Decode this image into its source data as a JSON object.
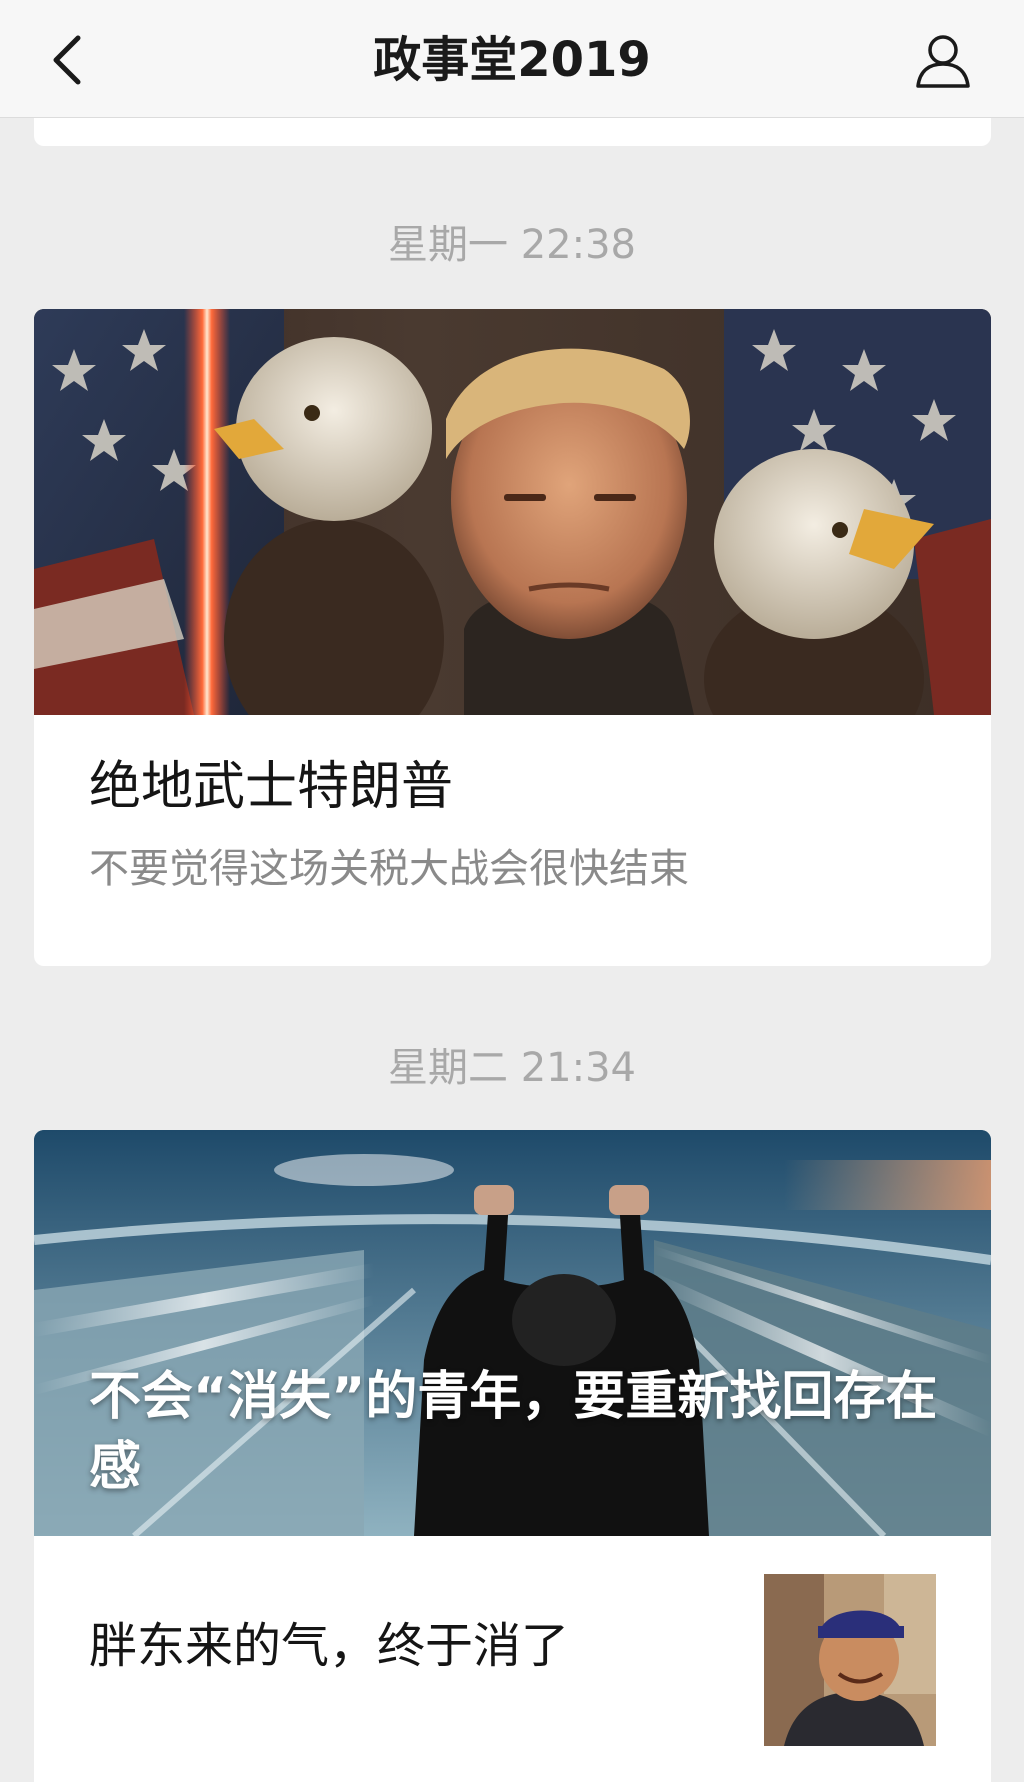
{
  "nav": {
    "title": "政事堂2019",
    "back_icon": "chevron-left-icon",
    "profile_icon": "person-icon"
  },
  "feed": [
    {
      "timestamp": "星期一 22:38",
      "cover_alt": "eagles-and-flag-painting",
      "title": "绝地武士特朗普",
      "description": "不要觉得这场关税大战会很快结束"
    },
    {
      "timestamp": "星期二 21:34",
      "cover_title": "不会“消失”的青年，要重新找回存在感",
      "sub_title": "胖东来的气，终于消了"
    }
  ],
  "colors": {
    "background": "#ededed",
    "card": "#ffffff",
    "timestamp": "#a8a8a8",
    "description": "#8a8a8a"
  }
}
